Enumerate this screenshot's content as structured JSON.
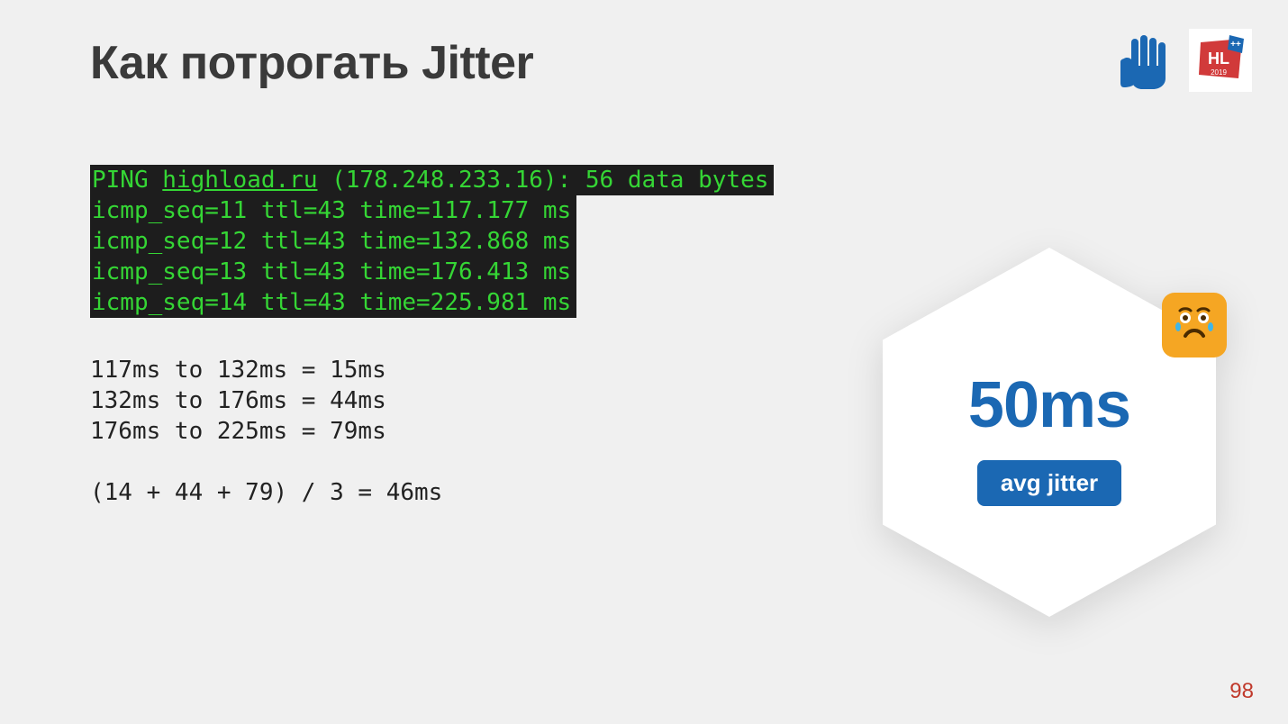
{
  "title": "Как потрогать Jitter",
  "terminal": {
    "line1_pre": "PING ",
    "line1_link": "highload.ru",
    "line1_post": " (178.248.233.16): 56 data bytes",
    "line2": "icmp_seq=11 ttl=43 time=117.177 ms",
    "line3": "icmp_seq=12 ttl=43 time=132.868 ms",
    "line4": "icmp_seq=13 ttl=43 time=176.413 ms",
    "line5": "icmp_seq=14 ttl=43 time=225.981 ms"
  },
  "calc": {
    "line1": "117ms to 132ms = 15ms",
    "line2": "132ms to 176ms = 44ms",
    "line3": "176ms to 225ms = 79ms",
    "blank": "",
    "line4": "(14 + 44 + 79) / 3 = 46ms"
  },
  "card": {
    "value": "50ms",
    "label": "avg jitter"
  },
  "logos": {
    "hand": "hand-stop-icon",
    "hl": "HL 2019"
  },
  "page_number": "98"
}
